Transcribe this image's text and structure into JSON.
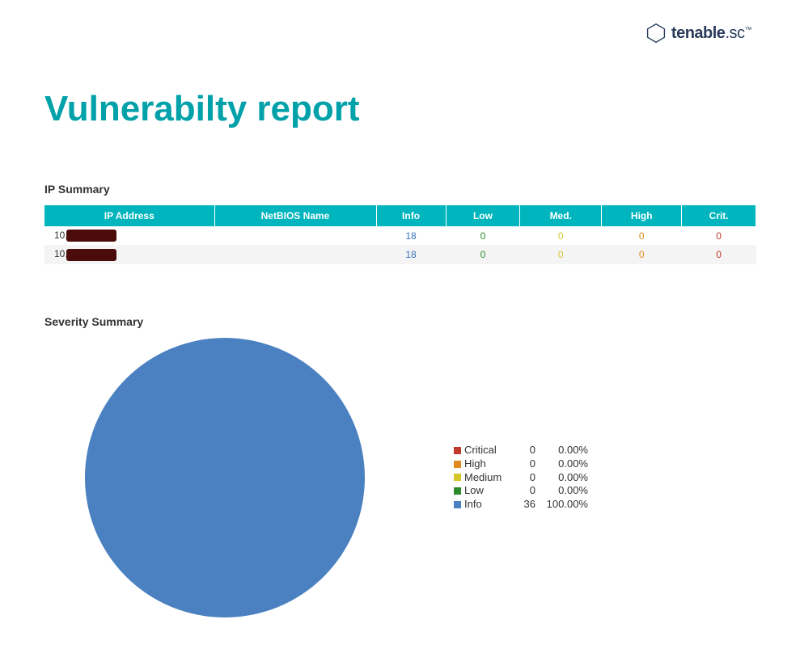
{
  "brand": {
    "name_bold": "tenable",
    "name_suffix": ".sc"
  },
  "title": "Vulnerabilty report",
  "ip_summary": {
    "heading": "IP Summary",
    "columns": {
      "ip": "IP Address",
      "netbios": "NetBIOS Name",
      "info": "Info",
      "low": "Low",
      "med": "Med.",
      "high": "High",
      "crit": "Crit."
    },
    "rows": [
      {
        "ip_prefix": "10.",
        "info": "18",
        "low": "0",
        "med": "0",
        "high": "0",
        "crit": "0"
      },
      {
        "ip_prefix": "10.",
        "info": "18",
        "low": "0",
        "med": "0",
        "high": "0",
        "crit": "0"
      }
    ]
  },
  "severity_summary": {
    "heading": "Severity Summary",
    "legend": [
      {
        "name": "Critical",
        "count": "0",
        "pct": "0.00%"
      },
      {
        "name": "High",
        "count": "0",
        "pct": "0.00%"
      },
      {
        "name": "Medium",
        "count": "0",
        "pct": "0.00%"
      },
      {
        "name": "Low",
        "count": "0",
        "pct": "0.00%"
      },
      {
        "name": "Info",
        "count": "36",
        "pct": "100.00%"
      }
    ]
  },
  "chart_data": {
    "type": "pie",
    "title": "Severity Summary",
    "series": [
      {
        "name": "Critical",
        "value": 0,
        "percent": 0.0,
        "color": "#c0392b"
      },
      {
        "name": "High",
        "value": 0,
        "percent": 0.0,
        "color": "#e08a1f"
      },
      {
        "name": "Medium",
        "value": 0,
        "percent": 0.0,
        "color": "#d4c72a"
      },
      {
        "name": "Low",
        "value": 0,
        "percent": 0.0,
        "color": "#2c8a2c"
      },
      {
        "name": "Info",
        "value": 36,
        "percent": 100.0,
        "color": "#4b81c1"
      }
    ]
  }
}
